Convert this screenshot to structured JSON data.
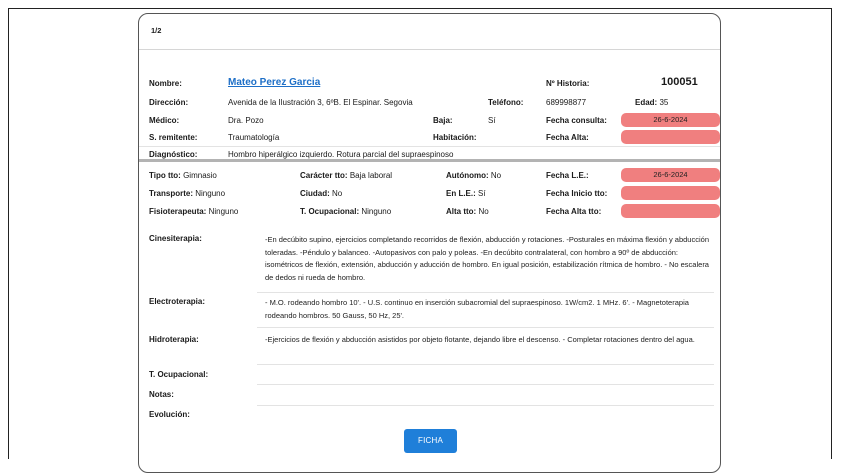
{
  "page": "1/2",
  "patient": {
    "nombre_label": "Nombre:",
    "nombre": "Mateo Perez Garcia",
    "historia_label": "Nº Historia:",
    "historia": "100051",
    "direccion_label": "Dirección:",
    "direccion": "Avenida de la Ilustración 3, 6ºB. El Espinar. Segovia",
    "telefono_label": "Teléfono:",
    "telefono": "689998877",
    "edad_label": "Edad:",
    "edad": "35",
    "medico_label": "Médico:",
    "medico": "Dra. Pozo",
    "baja_label": "Baja:",
    "baja": "Sí",
    "fecha_consulta_label": "Fecha consulta:",
    "fecha_consulta": "26-6-2024",
    "remitente_label": "S. remitente:",
    "remitente": "Traumatología",
    "habitacion_label": "Habitación:",
    "fecha_alta_label": "Fecha Alta:",
    "diagnostico_label": "Diagnóstico:",
    "diagnostico": "Hombro hiperálgico izquierdo. Rotura parcial del supraespinoso"
  },
  "treatment_info": {
    "tipo_label": "Tipo tto:",
    "tipo": "Gimnasio",
    "caracter_label": "Carácter tto:",
    "caracter": "Baja laboral",
    "autonomo_label": "Autónomo:",
    "autonomo": "No",
    "fecha_le_label": "Fecha L.E.:",
    "fecha_le": "26-6-2024",
    "transporte_label": "Transporte:",
    "transporte": "Ninguno",
    "ciudad_label": "Ciudad:",
    "ciudad": "No",
    "en_le_label": "En L.E.:",
    "en_le": "Sí",
    "fecha_inicio_label": "Fecha Inicio tto:",
    "fisio_label": "Fisioterapeuta:",
    "fisio": "Ninguno",
    "t_ocup_label": "T. Ocupacional:",
    "t_ocup": "Ninguno",
    "alta_tto_label": "Alta tto:",
    "alta_tto": "No",
    "fecha_alta_tto_label": "Fecha Alta tto:"
  },
  "therapies": {
    "cinesi_label": "Cinesiterapia:",
    "cinesi_text": "-En decúbito supino, ejercicios completando recorridos de flexión, abducción y rotaciones. -Posturales en máxima flexión y abducción toleradas. -Péndulo y balanceo. -Autopasivos con palo y poleas. -En decúbito contralateral, con hombro a 90º de abducción: isométricos de flexión, extensión, abducción y aducción de hombro. En igual posición, estabilización rítmica de hombro. - No escalera de dedos ni rueda de hombro.",
    "electro_label": "Electroterapia:",
    "electro_text": "- M.O. rodeando hombro 10'. - U.S. continuo en inserción subacromial del supraespinoso. 1W/cm2. 1 MHz. 6'. - Magnetoterapia rodeando hombros. 50 Gauss, 50 Hz, 25'.",
    "hidro_label": "Hidroterapia:",
    "hidro_text": "-Ejercicios de flexión y abducción asistidos por objeto flotante, dejando libre el descenso. - Completar rotaciones dentro del agua.",
    "t_ocup_label": "T. Ocupacional:",
    "notas_label": "Notas:",
    "evolucion_label": "Evolución:"
  },
  "ficha_button": "FICHA",
  "colors": {
    "pill": "#f07f7f",
    "button": "#1f7fd9",
    "link": "#1e6fc7"
  }
}
